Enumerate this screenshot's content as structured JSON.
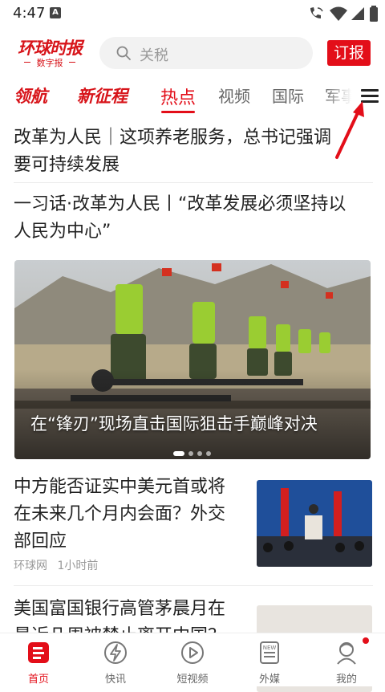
{
  "status_bar": {
    "time": "4:47",
    "sim_label": "A"
  },
  "header": {
    "logo_text": "环球时报",
    "logo_sub": "数字报",
    "search_placeholder": "关税",
    "subscribe_label": "订报"
  },
  "tabs": [
    {
      "label": "领航",
      "kind": "brand"
    },
    {
      "label": "新征程",
      "kind": "brand"
    },
    {
      "label": "热点",
      "kind": "active"
    },
    {
      "label": "视频",
      "kind": "normal"
    },
    {
      "label": "国际",
      "kind": "normal"
    },
    {
      "label": "军事",
      "kind": "normal"
    }
  ],
  "feed": {
    "items": [
      {
        "title_line1": "改革为人民｜这项养老服务，总书记强调",
        "title_line2": "要可持续发展"
      },
      {
        "title_line1": "一习话·改革为人民丨“改革发展必须坚持以",
        "title_line2": "人民为中心”"
      }
    ],
    "hero": {
      "caption": "在“锋刃”现场直击国际狙击手巅峰对决",
      "slides": 4,
      "active_slide": 0
    },
    "article1": {
      "title_line1": "中方能否证实中美元首或将",
      "title_line2": "在未来几个月内会面？外交",
      "title_line3": "部回应",
      "source": "环球网",
      "time": "1小时前"
    },
    "article2": {
      "title_line1": "美国富国银行高管茅晨月在",
      "title_line2": "最近几周被禁止离开中国？"
    }
  },
  "bottom_nav": [
    {
      "label": "首页",
      "icon": "home-icon",
      "active": true
    },
    {
      "label": "快讯",
      "icon": "flash-icon",
      "active": false
    },
    {
      "label": "短视频",
      "icon": "play-icon",
      "active": false
    },
    {
      "label": "外媒",
      "icon": "news-icon",
      "active": false
    },
    {
      "label": "我的",
      "icon": "profile-icon",
      "active": false
    }
  ],
  "colors": {
    "brand_red": "#e30e19",
    "text": "#222222",
    "muted": "#999999"
  }
}
